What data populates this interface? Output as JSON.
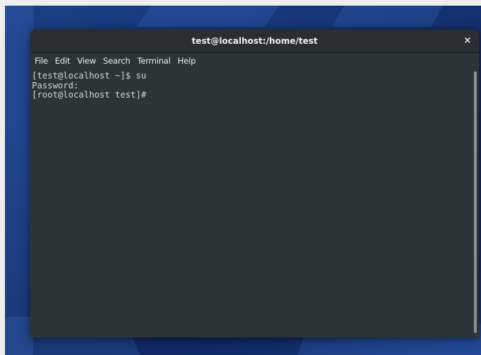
{
  "window": {
    "title": "test@localhost:/home/test",
    "close_label": "×"
  },
  "menu": {
    "items": [
      {
        "label": "File"
      },
      {
        "label": "Edit"
      },
      {
        "label": "View"
      },
      {
        "label": "Search"
      },
      {
        "label": "Terminal"
      },
      {
        "label": "Help"
      }
    ]
  },
  "terminal": {
    "lines": [
      "[test@localhost ~]$ su",
      "Password:",
      "[root@localhost test]#"
    ]
  },
  "colors": {
    "terminal_bg": "#2e3436",
    "terminal_fg": "#d3d7cf",
    "titlebar_bg": "#2b2e30",
    "desktop_bg": "#163577"
  },
  "icons": {
    "close": "close-icon"
  }
}
